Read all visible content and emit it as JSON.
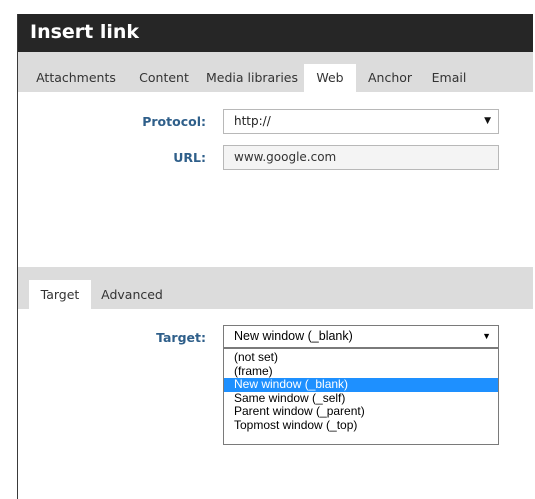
{
  "dialog": {
    "title": "Insert link"
  },
  "top_tabs": [
    {
      "label": "Attachments"
    },
    {
      "label": "Content"
    },
    {
      "label": "Media libraries"
    },
    {
      "label": "Web",
      "active": true
    },
    {
      "label": "Anchor"
    },
    {
      "label": "Email"
    }
  ],
  "web": {
    "protocol_label": "Protocol:",
    "protocol_value": "http://",
    "url_label": "URL:",
    "url_value": "www.google.com"
  },
  "bottom_tabs": [
    {
      "label": "Target",
      "active": true
    },
    {
      "label": "Advanced"
    }
  ],
  "target": {
    "label": "Target:",
    "value": "New window (_blank)",
    "options": [
      "(not set)",
      "(frame)",
      "New window (_blank)",
      "Same window (_self)",
      "Parent window (_parent)",
      "Topmost window (_top)"
    ],
    "selected_index": 2
  },
  "icons": {
    "dropdown": "chevron-down-icon"
  },
  "colors": {
    "titlebar": "#262626",
    "label": "#2f5f8a",
    "selection": "#1e90ff",
    "tabbar": "#dcdcdc"
  }
}
